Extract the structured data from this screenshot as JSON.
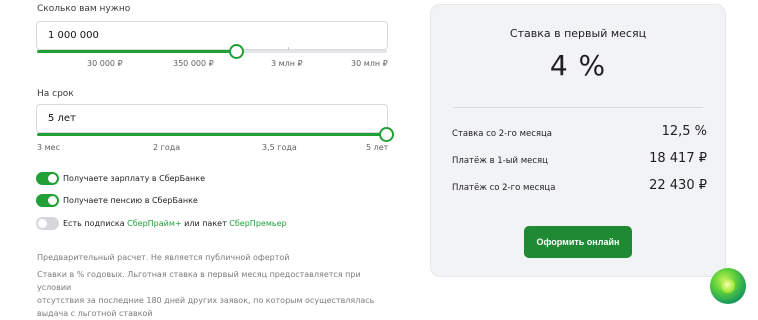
{
  "amount": {
    "label": "Сколько вам нужно",
    "value": "1 000 000",
    "slider_fraction": 0.57,
    "ticks": [
      "30 000 ₽",
      "350 000 ₽",
      "3 млн ₽",
      "30 млн ₽"
    ]
  },
  "term": {
    "label": "На срок",
    "value": "5 лет",
    "slider_fraction": 1.0,
    "ticks": [
      "3 мес",
      "2 года",
      "3,5 года",
      "5 лет"
    ]
  },
  "toggles": [
    {
      "text": "Получаете зарплату в СберБанке",
      "on": true
    },
    {
      "text": "Получаете пенсию в СберБанке",
      "on": true
    },
    {
      "text_prefix": "Есть подписка ",
      "link1": "СберПрайм+",
      "text_middle": " или пакет ",
      "link2": "СберПремьер",
      "on": false
    }
  ],
  "notes": {
    "preliminary": "Предварительный расчет. Не является публичной офертой",
    "line1": "Ставки в % годовых. Льготная ставка в первый месяц предоставляется при условии",
    "line2": "отсутствия за последние 180 дней других заявок, по которым осуществлялась",
    "line3": "выдача с льготной ставкой"
  },
  "summary": {
    "first_month_title": "Ставка в первый месяц",
    "first_month_rate": "4 %",
    "rows": [
      {
        "label": "Ставка со 2-го месяца",
        "value": "12,5 %"
      },
      {
        "label": "Платёж в 1-ый месяц",
        "value": "18 417 ₽"
      },
      {
        "label": "Платёж со 2-го месяца",
        "value": "22 430 ₽"
      }
    ],
    "cta_label": "Оформить онлайн"
  },
  "colors": {
    "accent": "#21a038",
    "cta": "#1f8a33",
    "card_bg": "#f2f3f5"
  },
  "icons": {
    "assistant": "sber-assistant-orb-icon"
  }
}
